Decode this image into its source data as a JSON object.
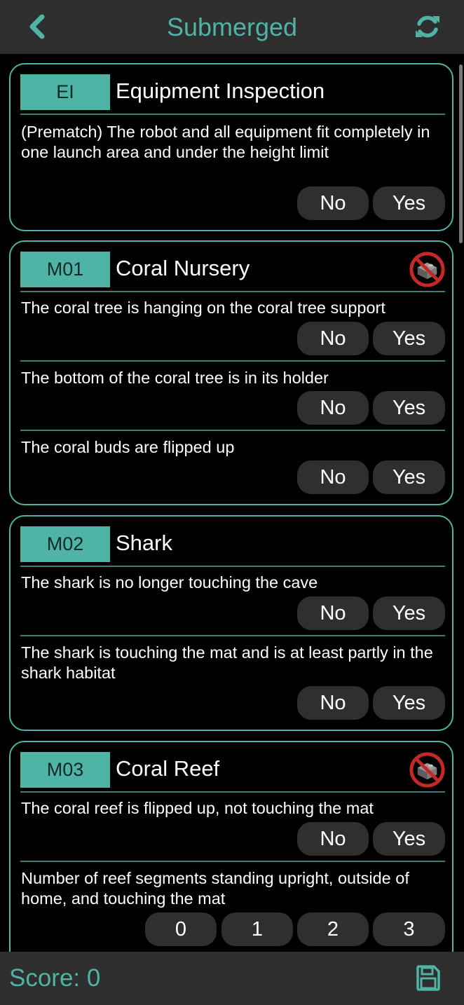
{
  "header": {
    "title": "Submerged",
    "back_icon": "chevron-left-icon",
    "refresh_icon": "refresh-icon"
  },
  "missions": [
    {
      "code": "EI",
      "title": "Equipment Inspection",
      "questions": [
        {
          "text": "(Prematch) The robot and all equipment fit completely in one launch area and under the height limit",
          "options": [
            "No",
            "Yes"
          ]
        }
      ]
    },
    {
      "code": "M01",
      "title": "Coral Nursery",
      "icon": "no-robot-icon",
      "questions": [
        {
          "text": "The coral tree is hanging on the coral tree support",
          "options": [
            "No",
            "Yes"
          ]
        },
        {
          "text": "The bottom of the coral tree is in its holder",
          "options": [
            "No",
            "Yes"
          ]
        },
        {
          "text": "The coral buds are flipped up",
          "options": [
            "No",
            "Yes"
          ]
        }
      ]
    },
    {
      "code": "M02",
      "title": "Shark",
      "questions": [
        {
          "text": "The shark is no longer touching the cave",
          "options": [
            "No",
            "Yes"
          ]
        },
        {
          "text": "The shark is touching the mat and is at least partly in the shark habitat",
          "options": [
            "No",
            "Yes"
          ]
        }
      ]
    },
    {
      "code": "M03",
      "title": "Coral Reef",
      "icon": "no-robot-icon",
      "questions": [
        {
          "text": "The coral reef is flipped up, not touching the mat",
          "options": [
            "No",
            "Yes"
          ]
        },
        {
          "text": "Number of reef segments standing upright, outside of home, and touching the mat",
          "options": [
            "0",
            "1",
            "2",
            "3"
          ]
        }
      ]
    }
  ],
  "footer": {
    "score_text": "Score: 0",
    "save_icon": "save-icon"
  },
  "colors": {
    "accent": "#4fb3a5",
    "bar_bg": "#2e2e2e",
    "button_bg": "#2f2f2f",
    "no_robot_red": "#c62828"
  }
}
